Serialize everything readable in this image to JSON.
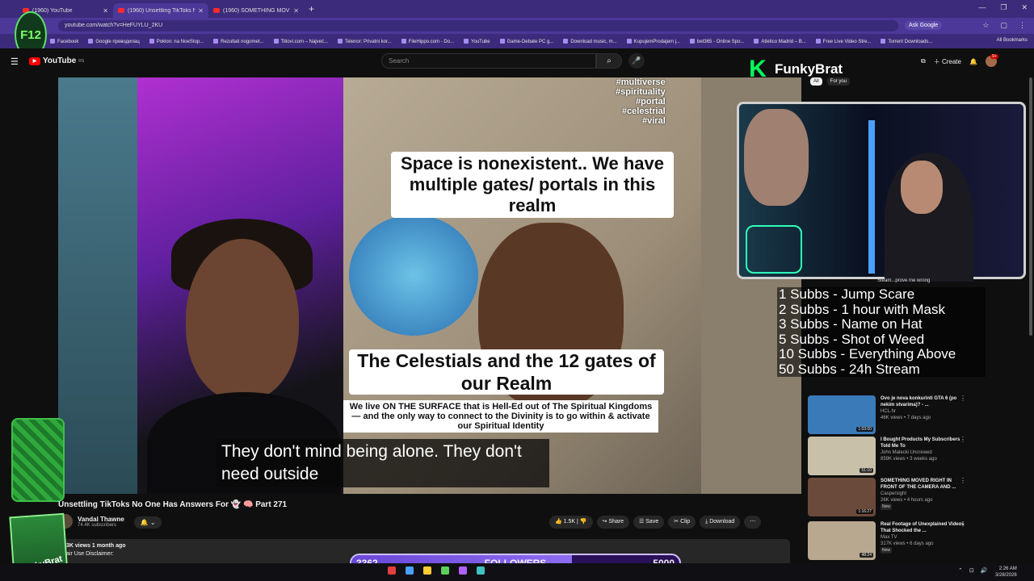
{
  "browser": {
    "tabs": [
      {
        "label": "(1960) YouTube"
      },
      {
        "label": "(1960) Unsettling TikToks N"
      },
      {
        "label": "(1960) SOMETHING MOVED RI"
      }
    ],
    "new_tab": "+",
    "url": "youtube.com/watch?v=HeFUYLU_2KU",
    "ask_google": "Ask Google",
    "bookmarks": [
      "Facebook",
      "Google преводилац",
      "Poklon: na NoeStop...",
      "Rezultati nogomet...",
      "Titlovi.com – Najveć...",
      "Telenor: Privatni kor...",
      "FileHippo.com - Do...",
      "YouTube",
      "Game-Debate PC g...",
      "Download music, m...",
      "KupujemProdajem j...",
      "bet365 - Online Spo...",
      "Atletico Madrid – B...",
      "Free Live Video Stre...",
      "Torrent Downloads..."
    ],
    "all_bookmarks": "All Bookmarks"
  },
  "badge": "F12",
  "youtube": {
    "logo": "YouTube",
    "region": "RS",
    "search_placeholder": "Search",
    "create": "Create",
    "notif_count": "9+",
    "chips": [
      "All",
      "For you"
    ]
  },
  "overlay": {
    "streamer": "FunkyBrat",
    "k": "K"
  },
  "video": {
    "tags": [
      "#multiverse",
      "#spirituality",
      "#portal",
      "#celestrial",
      "#viral"
    ],
    "caption1": "Space is nonexistent.. We have multiple gates/ portals in this realm",
    "caption2": "The Celestials and the 12 gates of our Realm",
    "caption3": "We live ON THE SURFACE that is Hell-Ed out of The Spiritual Kingdoms— and the only way to connect to the Divinity is to go within & activate our Spiritual Identity",
    "subtitle": "They don't mind being alone. They don't need outside"
  },
  "title": "Unsettling TikToks No One Has Answers For 👻 🧠 Part 271",
  "channel": {
    "name": "Vandal Thawne",
    "subs": "74.4K subscribers"
  },
  "actions": {
    "like": "1.5K",
    "share": "Share",
    "save": "Save",
    "clip": "Clip",
    "download": "Download"
  },
  "description": {
    "views": "3K views  1 month ago",
    "text": "air Use Disclaimer:"
  },
  "sub_goals": [
    "1 Subbs - Jump Scare",
    "2 Subbs - 1 hour with Mask",
    "3 Subbs - Name on Hat",
    "5 Subbs - Shot of Weed",
    "10 Subbs - Everything Above",
    "50 Subbs - 24h Stream"
  ],
  "sidebar_peek": "Steam...prove me wrong",
  "recommendations": [
    {
      "title": "Ovo je nova konkurinti GTA 6 (po nekim stvarima)? - ...",
      "channel": "HCL.hr",
      "views": "46K views • 7 days ago",
      "duration": "1:03:00",
      "color": "#3a7ab8"
    },
    {
      "title": "I Bought Products My Subscribers Told Me To",
      "channel": "John Malecki Uncrewed",
      "views": "859K views • 3 weeks ago",
      "duration": "51:10",
      "color": "#c8c0a8"
    },
    {
      "title": "SOMETHING MOVED RIGHT IN FRONT OF THE CAMERA AND ...",
      "channel": "Caspersight",
      "views": "26K views • 4 hours ago",
      "badge": "New",
      "duration": "1:16:27",
      "color": "#6a4a3a"
    },
    {
      "title": "Real Footage of Unexplained Videos That Shocked the ...",
      "channel": "Max TV",
      "views": "317K views • 6 days ago",
      "badge": "New",
      "duration": "48:24",
      "color": "#b8a890"
    }
  ],
  "followers": {
    "current": "3362",
    "label": "FOLLOWERS",
    "goal": "5000",
    "fraction": 0.672
  },
  "clock": {
    "time": "2:26 AM",
    "date": "3/28/2026"
  },
  "colors": {
    "tab_bar": "#3c2a7a",
    "address_bar": "#4c3898",
    "youtube_red": "#ff0000",
    "overlay_green": "#00ff5a"
  }
}
